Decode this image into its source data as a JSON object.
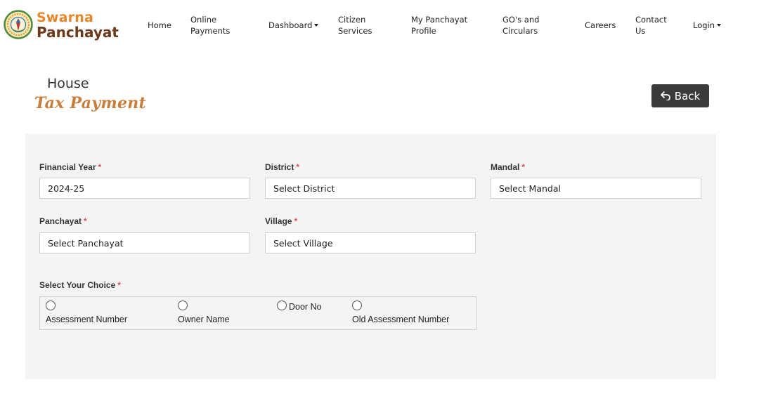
{
  "brand": {
    "line1": "Swarna",
    "line2": "Panchayat"
  },
  "nav": {
    "home": "Home",
    "online_payments_1": "Online",
    "online_payments_2": "Payments",
    "dashboard": "Dashboard",
    "citizen_1": "Citizen",
    "citizen_2": "Services",
    "profile_1": "My Panchayat",
    "profile_2": "Profile",
    "gos_1": "GO's and",
    "gos_2": "Circulars",
    "careers": "Careers",
    "contact_1": "Contact",
    "contact_2": "Us",
    "login": "Login"
  },
  "page": {
    "title_line1": "House",
    "title_line2": "Tax Payment",
    "back_label": "Back"
  },
  "form": {
    "required_mark": "*",
    "financial_year": {
      "label": "Financial Year",
      "value": "2024-25"
    },
    "district": {
      "label": "District",
      "value": "Select District"
    },
    "mandal": {
      "label": "Mandal",
      "value": "Select Mandal"
    },
    "panchayat": {
      "label": "Panchayat",
      "value": "Select Panchayat"
    },
    "village": {
      "label": "Village",
      "value": "Select Village"
    },
    "choice": {
      "label": "Select Your Choice",
      "options": [
        "Assessment Number",
        "Owner Name",
        "Door No",
        "Old Assessment Number"
      ]
    }
  },
  "colors": {
    "brand_orange": "#e8862a",
    "brand_brown": "#6b3a1a",
    "title_accent": "#c97d3a",
    "required": "#d9534f",
    "panel_bg": "#f4f4f4",
    "button_bg": "#3a3a3a"
  },
  "icons": {
    "logo": "state-emblem-icon",
    "back": "return-arrow-icon"
  }
}
